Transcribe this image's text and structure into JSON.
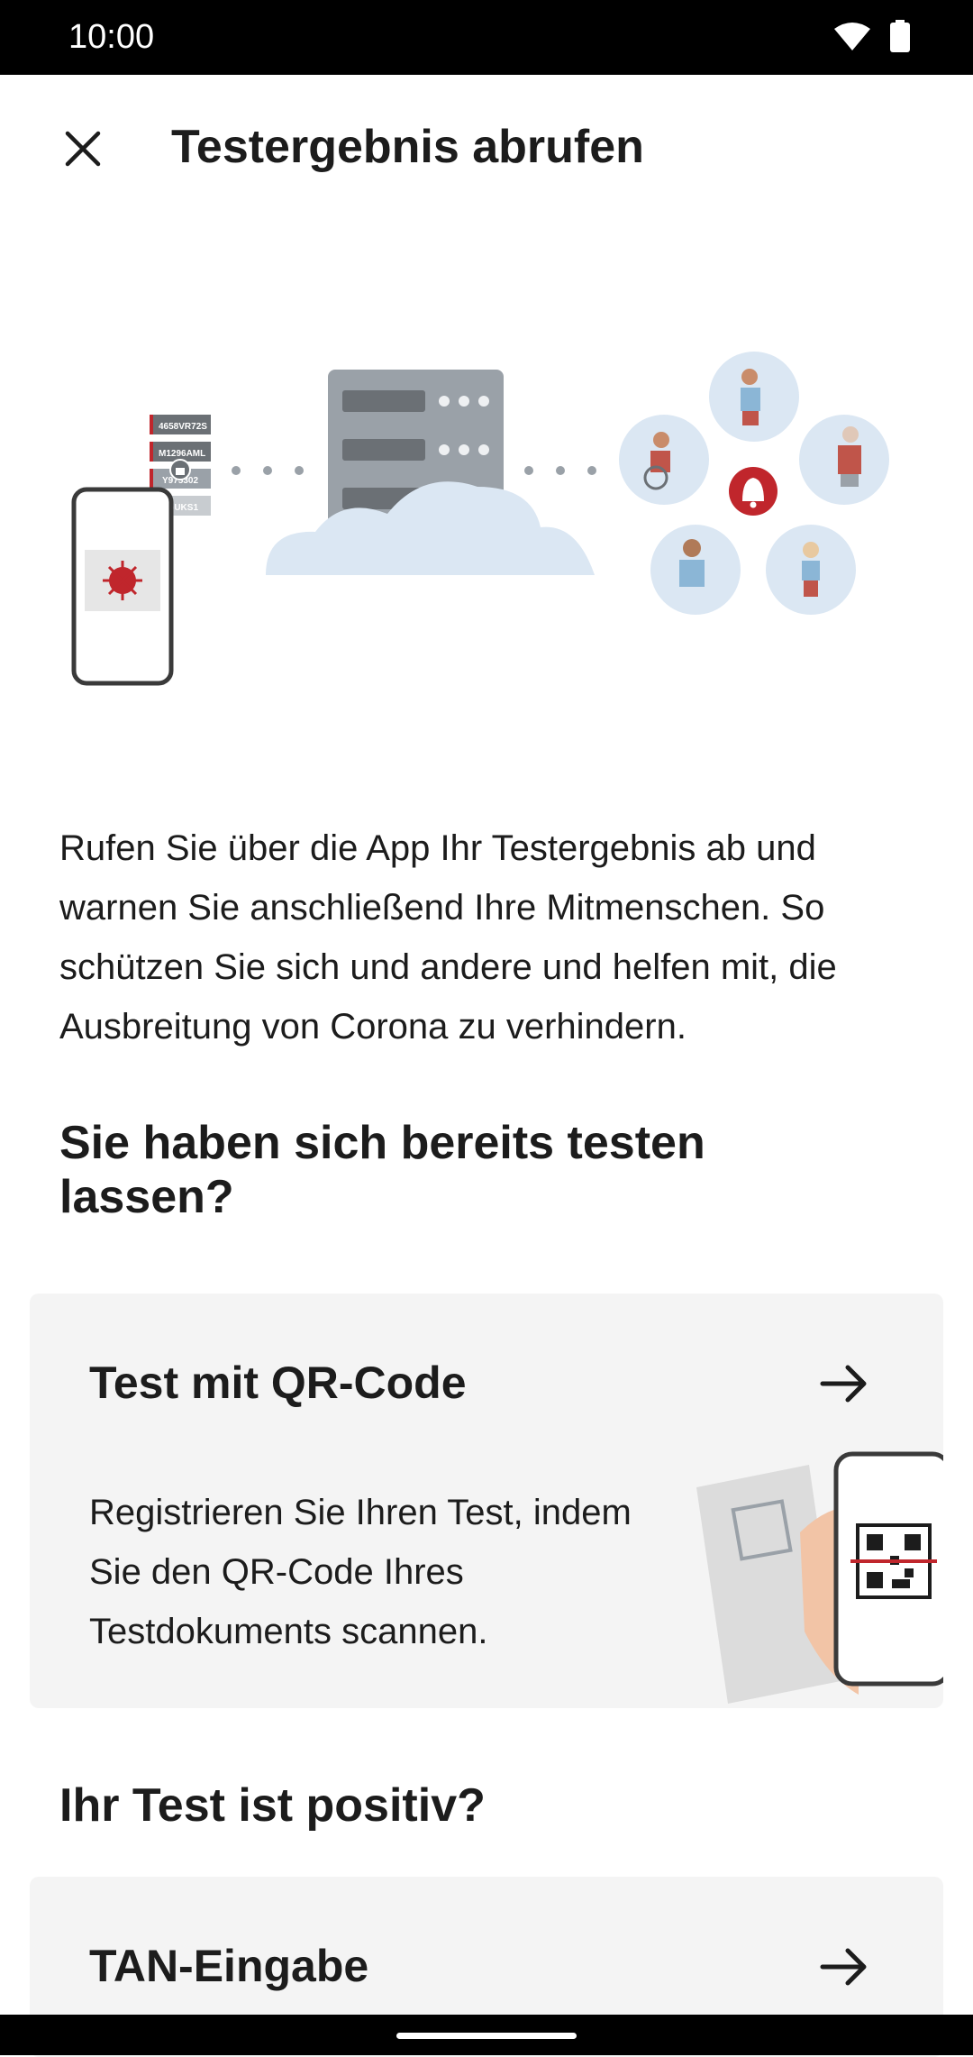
{
  "status_bar": {
    "time": "10:00",
    "icons": [
      "wifi-icon",
      "battery-icon"
    ]
  },
  "header": {
    "title": "Testergebnis abrufen",
    "close_icon": "close-icon"
  },
  "illustration": {
    "codes": [
      "4658VR72S",
      "M1296AML",
      "Y975302",
      "4GUKS1"
    ]
  },
  "intro_text": "Rufen Sie über die App Ihr Testergebnis ab und warnen Sie anschließend Ihre Mitmenschen. So schützen Sie sich und andere und helfen mit, die Ausbreitung von Corona zu verhindern.",
  "section1": {
    "heading": "Sie haben sich bereits testen lassen?"
  },
  "qr_card": {
    "title": "Test mit QR-Code",
    "text": "Registrieren Sie Ihren Test, indem Sie den QR-Code Ihres Testdokuments scannen.",
    "arrow_icon": "arrow-right-icon"
  },
  "section2": {
    "heading": "Ihr Test ist positiv?"
  },
  "tan_card": {
    "title": "TAN-Eingabe",
    "arrow_icon": "arrow-right-icon"
  },
  "colors": {
    "accent_red": "#c0262c",
    "card_bg": "#f4f4f4",
    "server_gray": "#9aa1a8",
    "cloud_blue": "#dbe7f3"
  }
}
